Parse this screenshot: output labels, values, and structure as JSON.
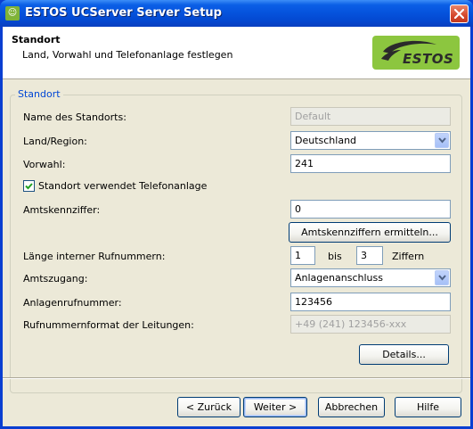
{
  "window": {
    "title": "ESTOS UCServer Server Setup"
  },
  "header": {
    "title": "Standort",
    "subtitle": "Land, Vorwahl und Telefonanlage festlegen",
    "logo_text": "ESTOS",
    "logo_color": "#8cc63f"
  },
  "group": {
    "title": "Standort"
  },
  "form": {
    "name_label": "Name des Standorts:",
    "name_placeholder": "Default",
    "country_label": "Land/Region:",
    "country_value": "Deutschland",
    "area_code_label": "Vorwahl:",
    "area_code_value": "241",
    "uses_pbx_label": "Standort verwendet Telefonanlage",
    "uses_pbx_checked": true,
    "trunk_prefix_label": "Amtskennziffer:",
    "trunk_prefix_value": "0",
    "detect_prefix_button": "Amtskennziffern ermitteln...",
    "ext_length_label": "Länge interner Rufnummern:",
    "ext_length_from": "1",
    "ext_length_to_word": "bis",
    "ext_length_to": "3",
    "ext_length_unit": "Ziffern",
    "line_access_label": "Amtszugang:",
    "line_access_value": "Anlagenanschluss",
    "pbx_number_label": "Anlagenrufnummer:",
    "pbx_number_value": "123456",
    "number_format_label": "Rufnummernformat der Leitungen:",
    "number_format_value": "+49 (241) 123456-xxx",
    "details_button": "Details..."
  },
  "footer": {
    "back": "< Zurück",
    "next": "Weiter >",
    "cancel": "Abbrechen",
    "help": "Hilfe"
  }
}
